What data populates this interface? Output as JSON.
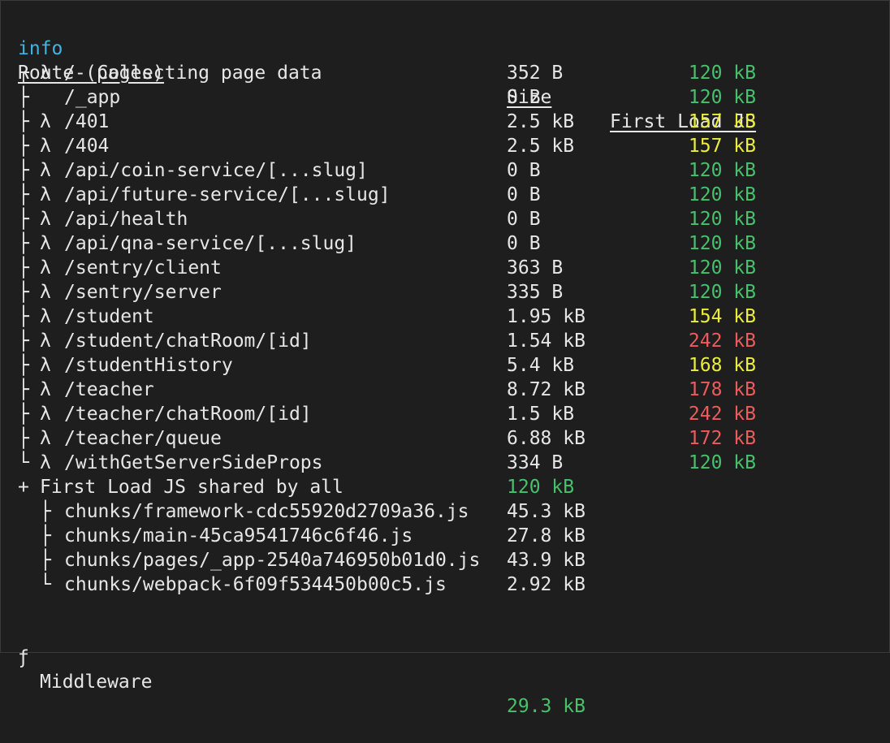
{
  "header": {
    "info_tag": "info",
    "info_text": " - Collecting page data"
  },
  "columns": {
    "route": "Route (pages)",
    "size": "Size",
    "first_load": "First Load JS"
  },
  "routes": [
    {
      "tree": "┌",
      "lambda": "λ",
      "path": "/",
      "size": "352 B",
      "load": "120 kB",
      "color": "green"
    },
    {
      "tree": "├",
      "lambda": "",
      "path": "/_app",
      "size": "0 B",
      "load": "120 kB",
      "color": "green"
    },
    {
      "tree": "├",
      "lambda": "λ",
      "path": "/401",
      "size": "2.5 kB",
      "load": "157 kB",
      "color": "yellow"
    },
    {
      "tree": "├",
      "lambda": "λ",
      "path": "/404",
      "size": "2.5 kB",
      "load": "157 kB",
      "color": "yellow"
    },
    {
      "tree": "├",
      "lambda": "λ",
      "path": "/api/coin-service/[...slug]",
      "size": "0 B",
      "load": "120 kB",
      "color": "green"
    },
    {
      "tree": "├",
      "lambda": "λ",
      "path": "/api/future-service/[...slug]",
      "size": "0 B",
      "load": "120 kB",
      "color": "green"
    },
    {
      "tree": "├",
      "lambda": "λ",
      "path": "/api/health",
      "size": "0 B",
      "load": "120 kB",
      "color": "green"
    },
    {
      "tree": "├",
      "lambda": "λ",
      "path": "/api/qna-service/[...slug]",
      "size": "0 B",
      "load": "120 kB",
      "color": "green"
    },
    {
      "tree": "├",
      "lambda": "λ",
      "path": "/sentry/client",
      "size": "363 B",
      "load": "120 kB",
      "color": "green"
    },
    {
      "tree": "├",
      "lambda": "λ",
      "path": "/sentry/server",
      "size": "335 B",
      "load": "120 kB",
      "color": "green"
    },
    {
      "tree": "├",
      "lambda": "λ",
      "path": "/student",
      "size": "1.95 kB",
      "load": "154 kB",
      "color": "yellow"
    },
    {
      "tree": "├",
      "lambda": "λ",
      "path": "/student/chatRoom/[id]",
      "size": "1.54 kB",
      "load": "242 kB",
      "color": "red"
    },
    {
      "tree": "├",
      "lambda": "λ",
      "path": "/studentHistory",
      "size": "5.4 kB",
      "load": "168 kB",
      "color": "yellow"
    },
    {
      "tree": "├",
      "lambda": "λ",
      "path": "/teacher",
      "size": "8.72 kB",
      "load": "178 kB",
      "color": "red"
    },
    {
      "tree": "├",
      "lambda": "λ",
      "path": "/teacher/chatRoom/[id]",
      "size": "1.5 kB",
      "load": "242 kB",
      "color": "red"
    },
    {
      "tree": "├",
      "lambda": "λ",
      "path": "/teacher/queue",
      "size": "6.88 kB",
      "load": "172 kB",
      "color": "red"
    },
    {
      "tree": "└",
      "lambda": "λ",
      "path": "/withGetServerSideProps",
      "size": "334 B",
      "load": "120 kB",
      "color": "green"
    }
  ],
  "shared": {
    "marker": "+",
    "label": "First Load JS shared by all",
    "size": "120 kB",
    "chunks": [
      {
        "tree": "├",
        "name": "chunks/framework-cdc55920d2709a36.js",
        "size": "45.3 kB"
      },
      {
        "tree": "├",
        "name": "chunks/main-45ca9541746c6f46.js",
        "size": "27.8 kB"
      },
      {
        "tree": "├",
        "name": "chunks/pages/_app-2540a746950b01d0.js",
        "size": "43.9 kB"
      },
      {
        "tree": "└",
        "name": "chunks/webpack-6f09f534450b00c5.js",
        "size": "2.92 kB"
      }
    ]
  },
  "middleware": {
    "symbol": "ƒ",
    "label": "Middleware",
    "size": "29.3 kB"
  },
  "colors": {
    "background": "#1e1e1e",
    "info": "#3fb4e6",
    "green": "#47c16b",
    "yellow": "#ecec3b",
    "red": "#ee5b5b"
  }
}
